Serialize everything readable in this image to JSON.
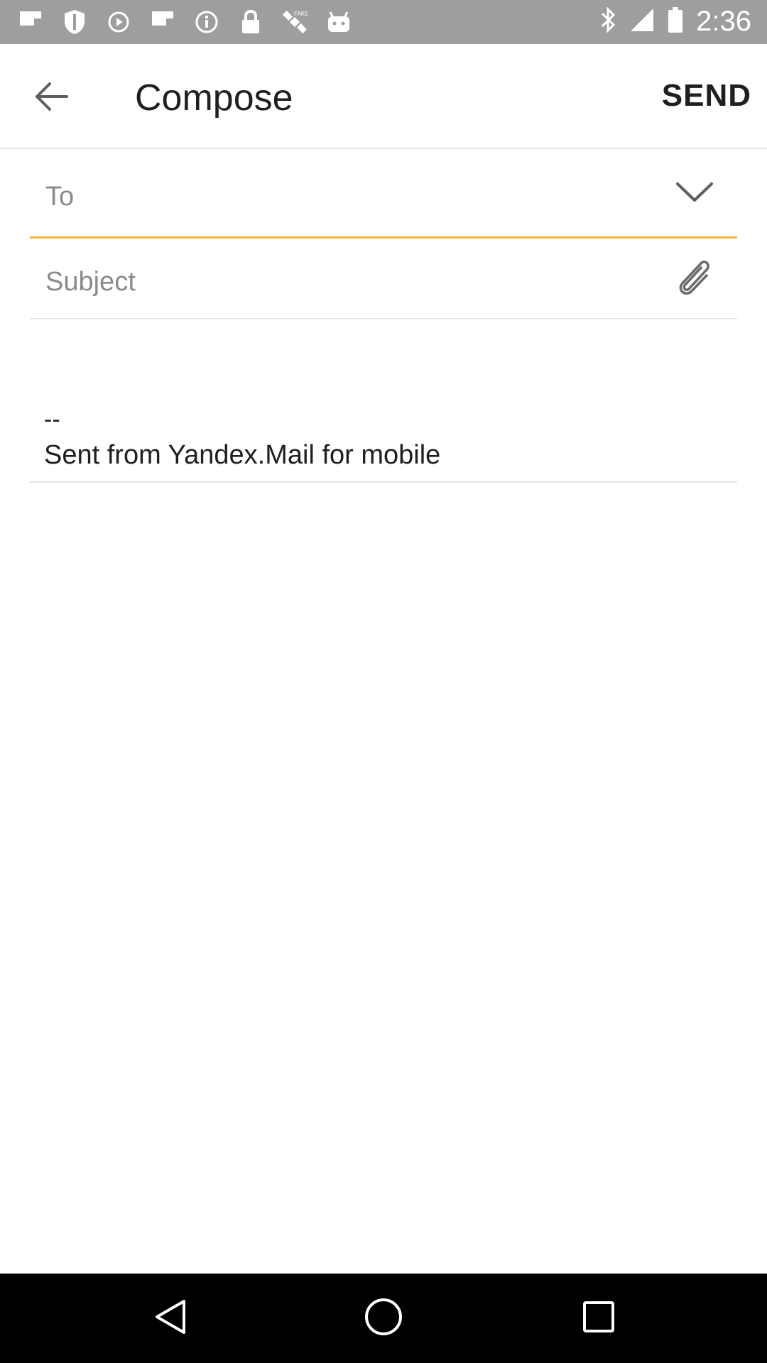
{
  "status_bar": {
    "time": "2:36",
    "icons": [
      "flipboard-icon",
      "shield-icon",
      "play-icon",
      "flipboard-icon",
      "info-icon",
      "lock-icon",
      "satellite-icon",
      "android-icon",
      "bluetooth-icon",
      "signal-icon",
      "battery-icon"
    ],
    "background": "#9e9e9e"
  },
  "app_bar": {
    "title": "Compose",
    "send_label": "SEND"
  },
  "form": {
    "to_placeholder": "To",
    "subject_placeholder": "Subject",
    "signature_separator": "--",
    "signature_text": "Sent from Yandex.Mail for mobile"
  },
  "colors": {
    "accent": "#f6b33a",
    "text": "#1f1f1f",
    "placeholder": "#8a8a8a"
  },
  "nav_bar": {
    "icons": [
      "nav-back-icon",
      "nav-home-icon",
      "nav-recent-icon"
    ]
  }
}
